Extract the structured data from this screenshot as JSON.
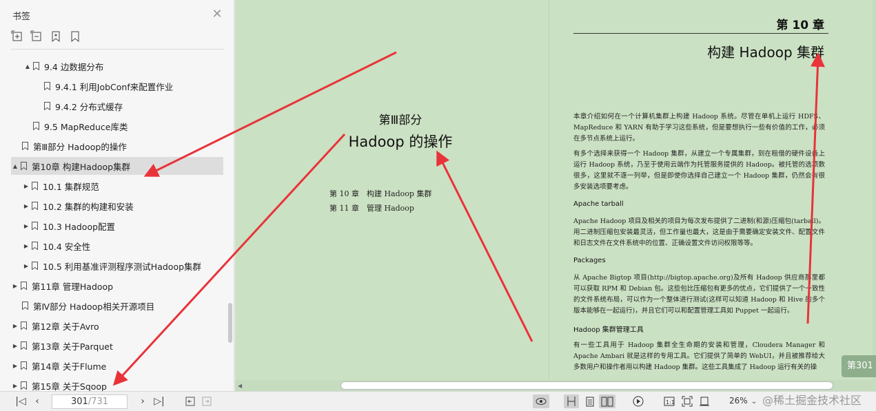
{
  "sidebar": {
    "title": "书签",
    "close_icon": "close-icon",
    "tools": [
      "expand-all-icon",
      "collapse-all-icon",
      "add-bookmark-icon",
      "bookmark-icon"
    ],
    "items": [
      {
        "label": "9.4 边数据分布",
        "arrow": "▲"
      },
      {
        "label": "9.4.1 利用JobConf来配置作业",
        "arrow": ""
      },
      {
        "label": "9.4.2 分布式缓存",
        "arrow": ""
      },
      {
        "label": "9.5 MapReduce库类",
        "arrow": ""
      },
      {
        "label": "第Ⅲ部分 Hadoop的操作",
        "arrow": ""
      },
      {
        "label": "第10章 构建Hadoop集群",
        "arrow": "▲"
      },
      {
        "label": "10.1 集群规范",
        "arrow": "▶"
      },
      {
        "label": "10.2 集群的构建和安装",
        "arrow": "▶"
      },
      {
        "label": "10.3 Hadoop配置",
        "arrow": "▶"
      },
      {
        "label": "10.4 安全性",
        "arrow": "▶"
      },
      {
        "label": "10.5 利用基准评测程序测试Hadoop集群",
        "arrow": "▶"
      },
      {
        "label": "第11章 管理Hadoop",
        "arrow": "▶"
      },
      {
        "label": "第Ⅳ部分 Hadoop相关开源项目",
        "arrow": ""
      },
      {
        "label": "第12章 关于Avro",
        "arrow": "▶"
      },
      {
        "label": "第13章 关于Parquet",
        "arrow": "▶"
      },
      {
        "label": "第14章 关于Flume",
        "arrow": "▶"
      },
      {
        "label": "第15章 关于Sqoop",
        "arrow": "▶"
      }
    ]
  },
  "left_page": {
    "part_no": "第Ⅲ部分",
    "part_name": "Hadoop 的操作",
    "toc": [
      "第 10 章　构建 Hadoop 集群",
      "第 11 章　管理 Hadoop"
    ]
  },
  "right_page": {
    "chapter_label": "第 10 章",
    "chapter_title": "构建 Hadoop 集群",
    "p1": "本章介绍如何在一个计算机集群上构建 Hadoop 系统。尽管在单机上运行 HDFS、MapReduce 和 YARN 有助于学习这些系统，但是要想执行一些有价值的工作，必须在多节点系统上运行。",
    "p2": "有多个选择来获得一个 Hadoop 集群，从建立一个专属集群，到在租借的硬件设备上运行 Hadoop 系统，乃至于使用云端作为托管服务提供的 Hadoop。被托管的选项数很多，这里就不逐一列举，但是即使你选择自己建立一个 Hadoop 集群，仍然会有很多安装选项要考虑。",
    "h1": "Apache tarball",
    "p3": "Apache Hadoop 项目及相关的项目为每次发布提供了二进制(和源)压缩包(tarball)。用二进制压缩包安装最灵活，但工作量也最大，这是由于需要确定安装文件、配置文件和日志文件在文件系统中的位置、正确设置文件访问权限等等。",
    "h2": "Packages",
    "p4": "从 Apache Bigtop 项目(http://bigtop.apache.org)及所有 Hadoop 供应商那里都可以获取 RPM 和 Debian 包。这些包比压缩包有更多的优点，它们提供了一个一致性的文件系统布局，可以作为一个整体进行测试(这样可以知道 Hadoop 和 Hive 的多个版本能够在一起运行)，并且它们可以和配置管理工具如 Puppet 一起运行。",
    "h3": "Hadoop 集群管理工具",
    "p5": "有一些工具用于 Hadoop 集群全生命期的安装和管理，Cloudera Manager 和 Apache Ambari 就是这样的专用工具。它们提供了简单的 WebUI，并且被推荐给大多数用户和操作者用以构建 Hadoop 集群。这些工具集成了 Hadoop 运行有关的操"
  },
  "page_badge": "第301",
  "bottombar": {
    "current_page": "301",
    "total_pages": "/731",
    "zoom": "26%"
  },
  "watermark": "@稀土掘金技术社区",
  "colors": {
    "page_bg": "#cbe1c3",
    "arrow": "#e8333a"
  }
}
